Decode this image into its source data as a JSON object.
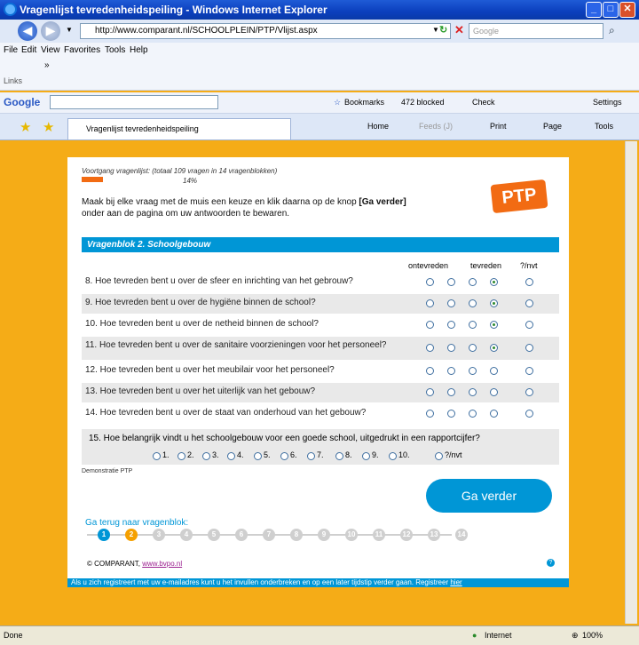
{
  "window": {
    "title": "Vragenlijst tevredenheidspeiling - Windows Internet Explorer"
  },
  "address": {
    "url": "http://www.comparant.nl/SCHOOLPLEIN/PTP/Vlijst.aspx",
    "search_placeholder": "Google"
  },
  "menu": {
    "items": [
      "File",
      "Edit",
      "View",
      "Favorites",
      "Tools",
      "Help"
    ],
    "links_label": "Links"
  },
  "googlebar": {
    "brand": "Google",
    "bookmarks": "Bookmarks",
    "blocked": "472 blocked",
    "check": "Check",
    "settings": "Settings"
  },
  "tab": {
    "label": "Vragenlijst tevredenheidspeiling",
    "home": "Home",
    "feeds": "Feeds (J)",
    "print": "Print",
    "page": "Page",
    "tools": "Tools"
  },
  "survey": {
    "progress_label": "Voortgang vragenlijst: (totaal 109 vragen in 14 vragenblokken)",
    "progress_value": "14%",
    "progress_fraction": 0.14,
    "instruction_1": "Maak bij elke vraag met de muis een keuze en klik daarna op de knop ",
    "instruction_bold": "[Ga verder]",
    "instruction_2": "onder aan de pagina om uw antwoorden te bewaren.",
    "logo": "PTP",
    "block_title": "Vragenblok 2. Schoolgebouw",
    "scale_low": "ontevreden",
    "scale_high": "tevreden",
    "scale_na": "?/nvt",
    "questions": [
      {
        "text": "8. Hoe tevreden bent u over de sfeer en inrichting van het gebrouw?",
        "selected": 3
      },
      {
        "text": "9. Hoe tevreden bent u over de hygiëne binnen de school?",
        "selected": 3
      },
      {
        "text": "10. Hoe tevreden bent u over de netheid binnen de school?",
        "selected": 3
      },
      {
        "text": "11. Hoe tevreden bent u over de sanitaire voorzieningen voor het personeel?",
        "selected": 3
      },
      {
        "text": "12. Hoe tevreden bent u over het meubilair voor het personeel?",
        "selected": -1
      },
      {
        "text": "13. Hoe tevreden bent u over het uiterlijk van het gebouw?",
        "selected": -1
      },
      {
        "text": "14. Hoe tevreden bent u over de staat van onderhoud van het gebouw?",
        "selected": -1
      }
    ],
    "q15": "15. Hoe belangrijk vindt u het schoolgebouw voor een goede school, uitgedrukt in een rapportcijfer?",
    "grades": [
      "1.",
      "2.",
      "3.",
      "4.",
      "5.",
      "6.",
      "7.",
      "8.",
      "9.",
      "10.",
      "?/nvt"
    ],
    "demo_label": "Demonstratie PTP",
    "next_button": "Ga verder",
    "back_label": "Ga terug naar vragenblok:",
    "steps": [
      "1",
      "2",
      "3",
      "4",
      "5",
      "6",
      "7",
      "8",
      "9",
      "10",
      "11",
      "12",
      "13",
      "14"
    ],
    "copyright": "© COMPARANT,",
    "copyright_link": "www.bvpo.nl",
    "register_text": "Als u zich registreert met uw e-mailadres kunt u het invullen onderbreken en op een later tijdstip verder gaan. Registreer",
    "register_link": "hier"
  },
  "status": {
    "left": "Done",
    "zone": "Internet",
    "zoom": "100%"
  }
}
